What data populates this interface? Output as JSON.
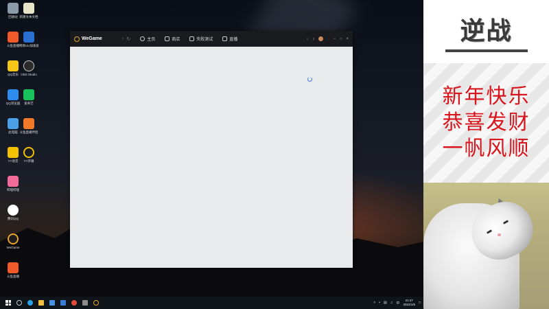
{
  "desktop": {
    "icons": [
      {
        "label": "回收站",
        "color": "#8a9aa8"
      },
      {
        "label": "新建文本文档",
        "color": "#e8e4c8"
      },
      {
        "label": "斗鱼直播",
        "color": "#f05a2a"
      },
      {
        "label": "网易UU加速器",
        "color": "#2a6fd0"
      },
      {
        "label": "QQ音乐",
        "color": "#f5c518"
      },
      {
        "label": "OBS Studio",
        "color": "#2b2b2b"
      },
      {
        "label": "QQ浏览器",
        "color": "#2e8bf0"
      },
      {
        "label": "爱奇艺",
        "color": "#19c15c"
      },
      {
        "label": "此电脑",
        "color": "#4aa0e6"
      },
      {
        "label": "斗鱼直播伴侣",
        "color": "#f07a2a"
      },
      {
        "label": "YY语音",
        "color": "#f2c200"
      },
      {
        "label": "YY开播",
        "color": "#f2c200"
      },
      {
        "label": "哔哩哔哩",
        "color": "#f06a9a"
      },
      {
        "label": "腾讯QQ",
        "color": "#ffffff"
      },
      {
        "label": "WeGame",
        "color": "#1e1e1e"
      },
      {
        "label": "斗鱼直播",
        "color": "#f05a2a"
      }
    ]
  },
  "wegame": {
    "logo": "WeGame",
    "tabs": [
      "主页",
      "商店",
      "失败测试",
      "直播"
    ],
    "accent": "#e8a32a",
    "spinner_color": "#3b7de0"
  },
  "taskbar": {
    "clock_time": "21:47",
    "clock_date": "2022/1/5",
    "lang": "中"
  },
  "panel": {
    "banner_title": "逆战",
    "greeting": [
      "新年快乐",
      "恭喜发财",
      "一帆风顺"
    ],
    "greeting_color": "#d8141c"
  }
}
